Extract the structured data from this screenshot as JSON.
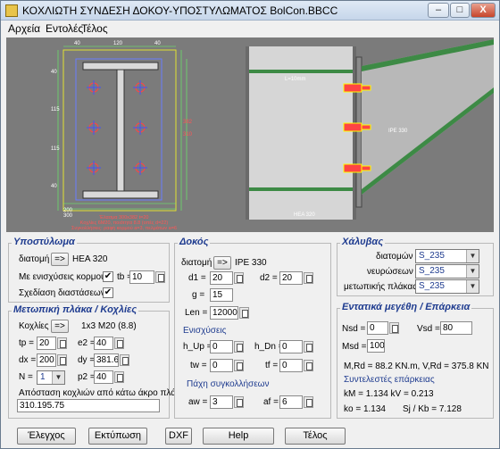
{
  "window": {
    "title": "ΚΟΧΛΙΩΤΗ ΣΥΝΔΕΣΗ ΔΟΚΟΥ-ΥΠΟΣΤΥΛΩΜΑΤΟΣ  BolCon.BBCC",
    "minimize": "–",
    "maximize": "□",
    "close": "X"
  },
  "menu": [
    "Αρχεία",
    "Εντολές",
    "Τέλος"
  ],
  "drawing": {
    "dims_top": [
      "40",
      "120",
      "40"
    ],
    "dims_left": [
      "40",
      "115",
      "115",
      "40"
    ],
    "dims_bottom": [
      "200",
      "300"
    ],
    "dims_right": [
      "382",
      "310"
    ],
    "notes": [
      "Έλασμα 300x382 t=20",
      "Κοχλίες 6M20, ποιότητα 8.8 (οπές d=22)",
      "Συγκολλήσεις: ραφή κορμού a=3, πελμάτων a=6"
    ],
    "beam_label": "IPE 330",
    "column_label": "HEA 320",
    "plate_label": "L=10mm"
  },
  "column": {
    "title": "Υποστύλωμα",
    "section_label": "διατομή",
    "section_btn": "=>",
    "section_value": "HEA 320",
    "stiff_label": "Με ενισχύσεις κορμού",
    "stiff_checked": "✔",
    "tb_label": "tb =",
    "tb_value": "10",
    "design_label": "Σχεδίαση διαστάσεων",
    "design_checked": "✔"
  },
  "plate": {
    "title": "Μετωπική πλάκα / Κοχλίες",
    "bolts_label": "Κοχλίες",
    "bolts_btn": "=>",
    "bolts_value": "1x3 M20 (8.8)",
    "tp_label": "tp =",
    "tp_value": "20",
    "e2_label": "e2 =",
    "e2_value": "40",
    "dx_label": "dx =",
    "dx_value": "200",
    "dy_label": "dy =",
    "dy_value": "381.6",
    "n_label": "N =",
    "n_value": "1",
    "p2_label": "p2 =",
    "p2_value": "40",
    "dist_label": "Απόσταση κοχλιών από κάτω άκρο πλάκας",
    "dist_value": "310.195.75"
  },
  "beam": {
    "title": "Δοκός",
    "section_label": "διατομή",
    "section_btn": "=>",
    "section_value": "IPE 330",
    "d1_label": "d1 =",
    "d1_value": "20",
    "d2_label": "d2 =",
    "d2_value": "20",
    "g_label": "g =",
    "g_value": "15",
    "len_label": "Len =",
    "len_value": "12000",
    "stiff_title": "Ενισχύσεις",
    "hup_label": "h_Up =",
    "hup_value": "0",
    "hdn_label": "h_Dn =",
    "hdn_value": "0",
    "tw_label": "tw =",
    "tw_value": "0",
    "tf_label": "tf =",
    "tf_value": "0",
    "weld_title": "Πάχη συγκολλήσεων",
    "aw_label": "aw =",
    "aw_value": "3",
    "af_label": "af =",
    "af_value": "6"
  },
  "steel": {
    "title": "Χάλυβας",
    "rows": [
      {
        "label": "διατομών",
        "value": "S_235"
      },
      {
        "label": "νευρώσεων",
        "value": "S_235"
      },
      {
        "label": "μετωπικής πλάκας",
        "value": "S_235"
      }
    ]
  },
  "forces": {
    "title": "Εντατικά μεγέθη / Επάρκεια",
    "nsd_label": "Nsd =",
    "nsd_value": "0",
    "vsd_label": "Vsd =",
    "vsd_value": "80",
    "msd_label": "Msd =",
    "msd_value": "100",
    "resist_line": "M,Rd = 88.2 KN.m,  V,Rd = 375.8 KN",
    "coef_title": "Συντελεστές επάρκειας",
    "coef_line1": "kM = 1.134  kV = 0.213",
    "ko_line": "ko = 1.134",
    "sj_line": "Sj / Kb = 7.128"
  },
  "buttons": {
    "check": "Έλεγχος",
    "print": "Εκτύπωση",
    "dxf": "DXF",
    "help": "Help",
    "end": "Τέλος"
  }
}
